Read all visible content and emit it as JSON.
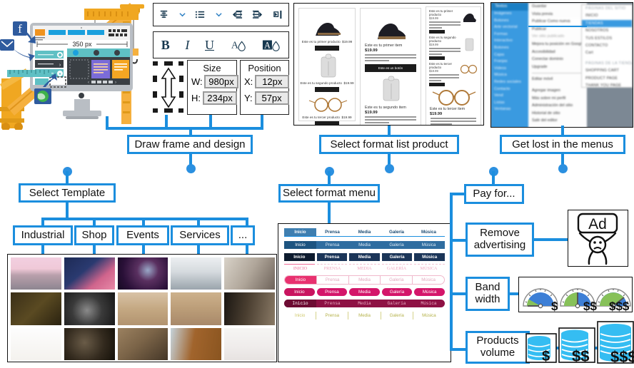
{
  "flow": {
    "boxes": {
      "draw_frame": "Draw frame and design",
      "select_template": "Select Template",
      "select_format_list": "Select format list product",
      "select_format_menu": "Select format menu",
      "get_lost": "Get lost in the menus",
      "pay_for": "Pay for...",
      "remove_advertising": "Remove advertising",
      "band_width": "Band width",
      "products_volume": "Products volume"
    },
    "template_categories": [
      "Industrial",
      "Shop",
      "Events",
      "Services",
      "..."
    ]
  },
  "editor": {
    "paragraph_toolbar": [
      {
        "icon": "line-spacing-icon",
        "label": "Line spacing"
      },
      {
        "icon": "chevron-down-icon",
        "label": "More"
      },
      {
        "icon": "bullet-list-icon",
        "label": "Bulleted list"
      },
      {
        "icon": "chevron-down-icon",
        "label": "More"
      },
      {
        "icon": "decrease-indent-icon",
        "label": "Decrease indent"
      },
      {
        "icon": "increase-indent-icon",
        "label": "Increase indent"
      },
      {
        "icon": "text-direction-icon",
        "label": "Text direction"
      }
    ],
    "format_toolbar": [
      {
        "icon": "bold-icon",
        "label": "B"
      },
      {
        "icon": "italic-icon",
        "label": "I"
      },
      {
        "icon": "underline-icon",
        "label": "U"
      },
      {
        "icon": "text-color-icon",
        "label": "A"
      },
      {
        "icon": "highlight-color-icon",
        "label": "A"
      }
    ],
    "size_panel": {
      "title": "Size",
      "width_label": "W:",
      "width_value": "980px",
      "height_label": "H:",
      "height_value": "234px"
    },
    "position_panel": {
      "title": "Position",
      "x_label": "X:",
      "x_value": "12px",
      "y_label": "Y:",
      "y_value": "57px"
    },
    "canvas_ruler_value": "350 px"
  },
  "product_list_preview": {
    "layouts": [
      {
        "name": "grid-compact",
        "items": [
          {
            "title": "Este es tu primer producto",
            "price": "$19.99",
            "button": "Ver el detalle"
          },
          {
            "title": "Este es tu segundo producto",
            "price": "$19.99",
            "button": "Ver el detalle"
          },
          {
            "title": "Este es tu tercer producto",
            "price": "$19.99",
            "button": "Ver el detalle"
          }
        ]
      },
      {
        "name": "stacked-large",
        "items": [
          {
            "title": "Este es tu primer item",
            "price": "$19.99",
            "body": "Ten people more about this item. What's it about and what makes it interesting? To make this item your own click here > Add & Manage Items.",
            "button": "Este es un botón"
          },
          {
            "title": "Este es tu segundo item",
            "price": "$19.99",
            "body": "Ten people more about this item. What's it about and what makes it interesting? To make this item your own click here > Add & Manage Items.",
            "button": "Este es un botón"
          }
        ]
      },
      {
        "name": "list-right-image",
        "items": [
          {
            "title": "Este es tu primer producto",
            "price": "$19.99",
            "button": "Ver el detalle"
          },
          {
            "title": "Este es tu segundo producto",
            "price": "$19.99",
            "button": "Ver el detalle"
          },
          {
            "title": "Este es tu tercer producto",
            "price": "$19.99",
            "button": "Ver el detalle"
          },
          {
            "title": "Este es tu tercer item",
            "price": "$19.99",
            "body": "Ten people more about this item. What's it about and what makes it interesting? To make this item your own click here > Add & Manage Items.",
            "button": "Este es un botón"
          }
        ]
      }
    ]
  },
  "menus_panel": {
    "sidebar_items": [
      "Textos",
      "Imágenes",
      "Botones",
      "Artes vectorial",
      "Formas",
      "Interactivo",
      "Botones",
      "Cajas",
      "Franjas",
      "Videos",
      "Música",
      "Redes sociales",
      "Contacto",
      "Vend",
      "Listas",
      "Ventanas"
    ],
    "mid_items": [
      "Guardar",
      "Vista previa",
      "Publicar Como nueva",
      "Publicar",
      "Ver sitio publicado",
      "Mejora tu posición en Google",
      "Accesibilidad",
      "Conectar dominio",
      "Upgrade",
      "Editar móvil",
      "Agregar imagen",
      "Más sobre mi perfil",
      "Administración del sitio",
      "Historial de sitio",
      "Salir del editor"
    ],
    "right_groups": [
      {
        "header": "PÁGINAS DEL SITIO",
        "items": [
          "INICIO",
          "TIENDAS",
          "NOSOTROS",
          "TUS ESTILOS",
          "CONTACTO",
          "Cart"
        ]
      },
      {
        "header": "PÁGINAS DE LA TIENDA",
        "items": [
          "SHOPPING CART",
          "PRODUCT PAGE",
          "THANK YOU PAGE"
        ]
      }
    ],
    "selected_sidebar": "Textos",
    "selected_right": "TIENDAS"
  },
  "menu_format_preview": {
    "labels": [
      "Inicio",
      "Prensa",
      "Media",
      "Galería",
      "Música"
    ],
    "variants": [
      {
        "name": "light-flat",
        "bg": "#ffffff",
        "fg": "#1b4b73",
        "active_bg": "#3f7fb0",
        "active_fg": "#ffffff",
        "underline": "#1b8ede"
      },
      {
        "name": "steel-blue",
        "bg": "#2f6da0",
        "fg": "#dce9f3",
        "active_bg": "#1d5480",
        "active_fg": "#ffffff"
      },
      {
        "name": "navy-tiles",
        "bg": "#ffffff",
        "fg": "#ffffff",
        "tile": "#1b3558",
        "active_bg": "#0d1b2e",
        "active_fg": "#ffffff"
      },
      {
        "name": "pink-caps",
        "bg": "#ffffff",
        "fg": "#f0a8c0",
        "active_fg": "#f06a98",
        "underline": "#f06a98"
      },
      {
        "name": "pink-pill-outline",
        "bg": "#ffffff",
        "fg": "#e3a9bf",
        "active_bg": "#e8316f",
        "active_fg": "#ffffff"
      },
      {
        "name": "pink-pills",
        "bg": "#ffffff",
        "fg": "#ffffff",
        "tile": "#d4166a",
        "active_bg": "#c9145f",
        "active_fg": "#ffffff"
      },
      {
        "name": "dark-maroon-bar",
        "bg": "#8e1144",
        "fg": "#e6a8c0",
        "active_bg": "#6d0c33",
        "active_fg": "#ffffff"
      },
      {
        "name": "olive-dividers",
        "bg": "#ffffff",
        "fg": "#b5b24a",
        "active_fg": "#cfc86a"
      }
    ]
  },
  "upsell": {
    "ad_icon_text": "Ad",
    "bandwidth_tiers": [
      "$",
      "$ $",
      "$ $ $"
    ],
    "products_tiers": [
      "$",
      "$ $",
      "$ $ $"
    ]
  },
  "colors": {
    "accent_blue": "#1b8ede",
    "dot_blue": "#2b90e0",
    "gauge_blue": "#3d7fd6",
    "gauge_green": "#87c159",
    "db_blue": "#35bdf2"
  }
}
